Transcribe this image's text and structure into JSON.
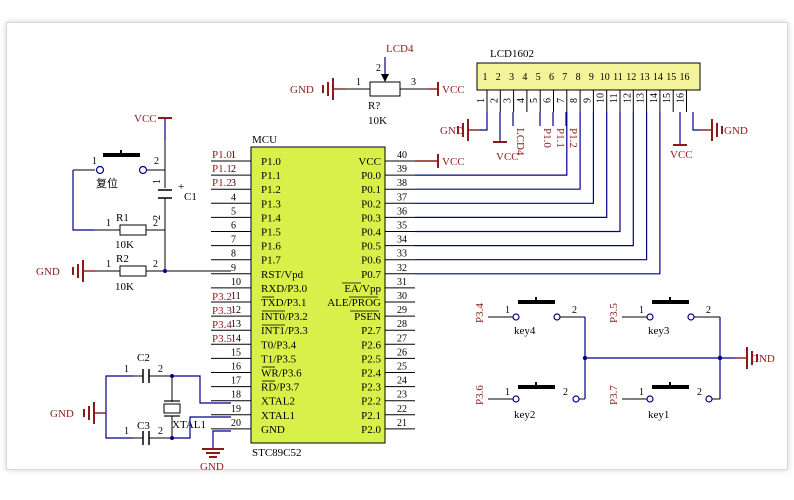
{
  "power": {
    "vcc": "VCC",
    "gnd": "GND"
  },
  "colors": {
    "wire": "#00008b",
    "power": "#8b1a1a",
    "mcu_fill": "#d8f04a",
    "lcd_fill": "#f3f39a"
  },
  "mcu": {
    "designator": "MCU",
    "part": "STC89C52",
    "left_pins": [
      {
        "num": "1",
        "name": "P1.0"
      },
      {
        "num": "2",
        "name": "P1.1"
      },
      {
        "num": "3",
        "name": "P1.2"
      },
      {
        "num": "4",
        "name": "P1.3"
      },
      {
        "num": "5",
        "name": "P1.4"
      },
      {
        "num": "6",
        "name": "P1.5"
      },
      {
        "num": "7",
        "name": "P1.6"
      },
      {
        "num": "8",
        "name": "P1.7"
      },
      {
        "num": "9",
        "name": "RST/Vpd"
      },
      {
        "num": "10",
        "name": "RXD/P3.0"
      },
      {
        "num": "11",
        "name": "TXD/P3.1"
      },
      {
        "num": "12",
        "name": "INT0/P3.2"
      },
      {
        "num": "13",
        "name": "INT1/P3.3"
      },
      {
        "num": "14",
        "name": "T0/P3.4"
      },
      {
        "num": "15",
        "name": "T1/P3.5"
      },
      {
        "num": "16",
        "name": "WR/P3.6"
      },
      {
        "num": "17",
        "name": "RD/P3.7"
      },
      {
        "num": "18",
        "name": "XTAL2"
      },
      {
        "num": "19",
        "name": "XTAL1"
      },
      {
        "num": "20",
        "name": "GND"
      }
    ],
    "right_pins": [
      {
        "num": "40",
        "name": "VCC"
      },
      {
        "num": "39",
        "name": "P0.0"
      },
      {
        "num": "38",
        "name": "P0.1"
      },
      {
        "num": "37",
        "name": "P0.2"
      },
      {
        "num": "36",
        "name": "P0.3"
      },
      {
        "num": "35",
        "name": "P0.4"
      },
      {
        "num": "34",
        "name": "P0.5"
      },
      {
        "num": "33",
        "name": "P0.6"
      },
      {
        "num": "32",
        "name": "P0.7"
      },
      {
        "num": "31",
        "name": "EA/Vpp"
      },
      {
        "num": "30",
        "name": "ALE/PROG"
      },
      {
        "num": "29",
        "name": "PSEN"
      },
      {
        "num": "28",
        "name": "P2.7"
      },
      {
        "num": "27",
        "name": "P2.6"
      },
      {
        "num": "26",
        "name": "P2.5"
      },
      {
        "num": "25",
        "name": "P2.4"
      },
      {
        "num": "24",
        "name": "P2.3"
      },
      {
        "num": "23",
        "name": "P2.2"
      },
      {
        "num": "22",
        "name": "P2.1"
      },
      {
        "num": "21",
        "name": "P2.0"
      }
    ],
    "net_labels_left": [
      "P1.0",
      "P1.1",
      "P1.2",
      "P3.2",
      "P3.3",
      "P3.4",
      "P3.5"
    ]
  },
  "lcd": {
    "designator": "LCD1602",
    "pins": [
      "1",
      "2",
      "3",
      "4",
      "5",
      "6",
      "7",
      "8",
      "9",
      "10",
      "11",
      "12",
      "13",
      "14",
      "15",
      "16"
    ],
    "net_labels": [
      "LCD4",
      "P1.0",
      "P1.1",
      "P1.2"
    ]
  },
  "pot": {
    "designator": "R?",
    "value": "10K",
    "wiper_net": "LCD4",
    "pin1": "1",
    "pin2": "2",
    "pin3": "3"
  },
  "reset": {
    "switch_label": "复位",
    "sw_pin1": "1",
    "sw_pin2": "2",
    "cap": "C1",
    "cap_pin1": "1",
    "cap_pin2": "2",
    "r1": "R1",
    "r1_value": "10K",
    "r2": "R2",
    "r2_value": "10K",
    "r_pin1": "1",
    "r_pin2": "2"
  },
  "crystal": {
    "c2": "C2",
    "c3": "C3",
    "xtal": "XTAL1",
    "pin1": "1",
    "pin2": "2"
  },
  "keys": [
    {
      "name": "key4",
      "net": "P3.4",
      "pin1": "1",
      "pin2": "2"
    },
    {
      "name": "key3",
      "net": "P3.5",
      "pin1": "1",
      "pin2": "2"
    },
    {
      "name": "key2",
      "net": "P3.6",
      "pin1": "1",
      "pin2": "2"
    },
    {
      "name": "key1",
      "net": "P3.7",
      "pin1": "1",
      "pin2": "2"
    }
  ]
}
